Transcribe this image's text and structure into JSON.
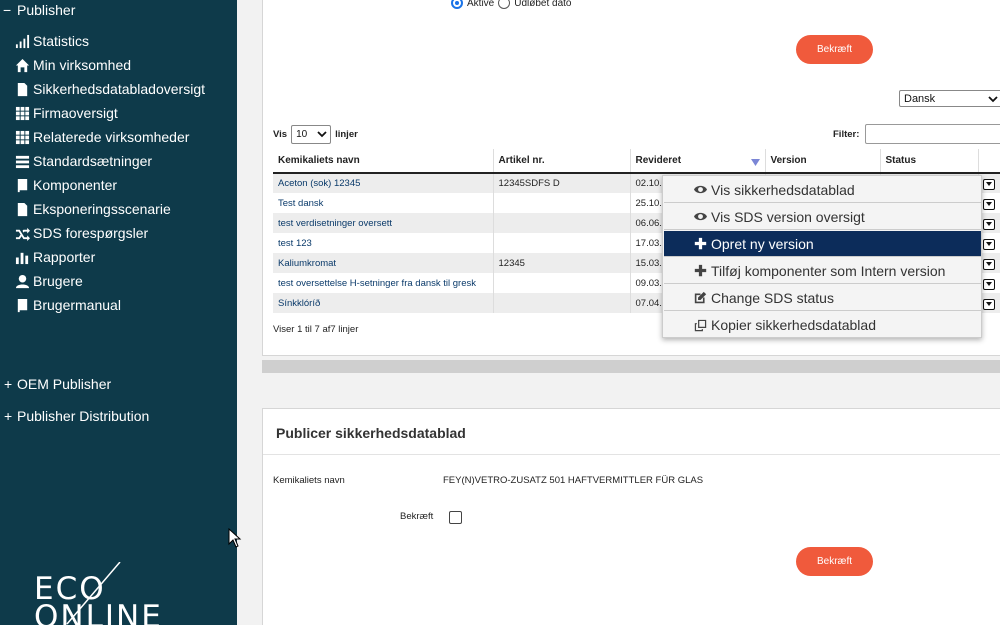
{
  "sidebar": {
    "header": {
      "sign": "−",
      "label": "Publisher"
    },
    "items": [
      {
        "label": "Statistics",
        "icon": "bar-chart-icon"
      },
      {
        "label": "Min virksomhed",
        "icon": "home-icon"
      },
      {
        "label": "Sikkerhedsdatabladoversigt",
        "icon": "file-icon"
      },
      {
        "label": "Firmaoversigt",
        "icon": "grid-icon"
      },
      {
        "label": "Relaterede virksomheder",
        "icon": "grid-icon"
      },
      {
        "label": "Standardsætninger",
        "icon": "list-icon"
      },
      {
        "label": "Komponenter",
        "icon": "book-icon"
      },
      {
        "label": "Eksponeringsscenarie",
        "icon": "file-icon"
      },
      {
        "label": "SDS forespørgsler",
        "icon": "shuffle-icon"
      },
      {
        "label": "Rapporter",
        "icon": "report-icon"
      },
      {
        "label": "Brugere",
        "icon": "user-icon"
      },
      {
        "label": "Brugermanual",
        "icon": "book-icon"
      }
    ],
    "groups": [
      {
        "sign": "+",
        "label": "OEM Publisher"
      },
      {
        "sign": "+",
        "label": "Publisher Distribution"
      }
    ],
    "logo": {
      "line1": "ECO",
      "line2": "ONLINE"
    }
  },
  "filter_panel": {
    "radio_active": "Aktive",
    "radio_expired": "Udløbet dato",
    "confirm_label": "Bekræft"
  },
  "language_select": {
    "value": "Dansk"
  },
  "table_controls": {
    "show_prefix": "Vis",
    "page_size": "10",
    "show_suffix": "linjer",
    "filter_label": "Filter:",
    "filter_value": ""
  },
  "table": {
    "columns": [
      "Kemikaliets navn",
      "Artikel nr.",
      "Revideret",
      "Version",
      "Status"
    ],
    "rows": [
      {
        "name": "Aceton (sok) 12345",
        "article": "12345SDFS D",
        "revised": "02.10."
      },
      {
        "name": "Test dansk",
        "article": "",
        "revised": "25.10."
      },
      {
        "name": "test verdisetninger oversett",
        "article": "",
        "revised": "06.06."
      },
      {
        "name": "test 123",
        "article": "",
        "revised": "17.03."
      },
      {
        "name": "Kaliumkromat",
        "article": "12345",
        "revised": "15.03."
      },
      {
        "name": "test oversettelse H-setninger fra dansk til gresk",
        "article": "",
        "revised": "09.03."
      },
      {
        "name": "Sínkklóríð",
        "article": "",
        "revised": "07.04."
      }
    ],
    "footer": "Viser 1 til 7 af7 linjer"
  },
  "context_menu": {
    "items": [
      {
        "label": "Vis sikkerhedsdatablad",
        "icon": "eye-icon",
        "active": false
      },
      {
        "label": "Vis SDS version oversigt",
        "icon": "eye-icon",
        "active": false
      },
      {
        "label": "Opret ny version",
        "icon": "plus-icon",
        "active": true
      },
      {
        "label": "Tilføj komponenter som Intern version",
        "icon": "plus-icon",
        "active": false
      },
      {
        "label": "Change SDS status",
        "icon": "edit-icon",
        "active": false
      },
      {
        "label": "Kopier sikkerhedsdatablad",
        "icon": "copy-icon",
        "active": false
      }
    ]
  },
  "publish_panel": {
    "title": "Publicer sikkerhedsdatablad",
    "name_label": "Kemikaliets navn",
    "name_value": "FEY(N)VETRO-ZUSATZ 501 HAFTVERMITTLER FÜR GLAS",
    "confirm_checkbox_label": "Bekræft",
    "confirm_button": "Bekræft"
  },
  "colors": {
    "sidebar_bg": "#0e3a4a",
    "button_red": "#f05a3c",
    "menu_active": "#0c2c5a",
    "link": "#0a3a6a"
  }
}
